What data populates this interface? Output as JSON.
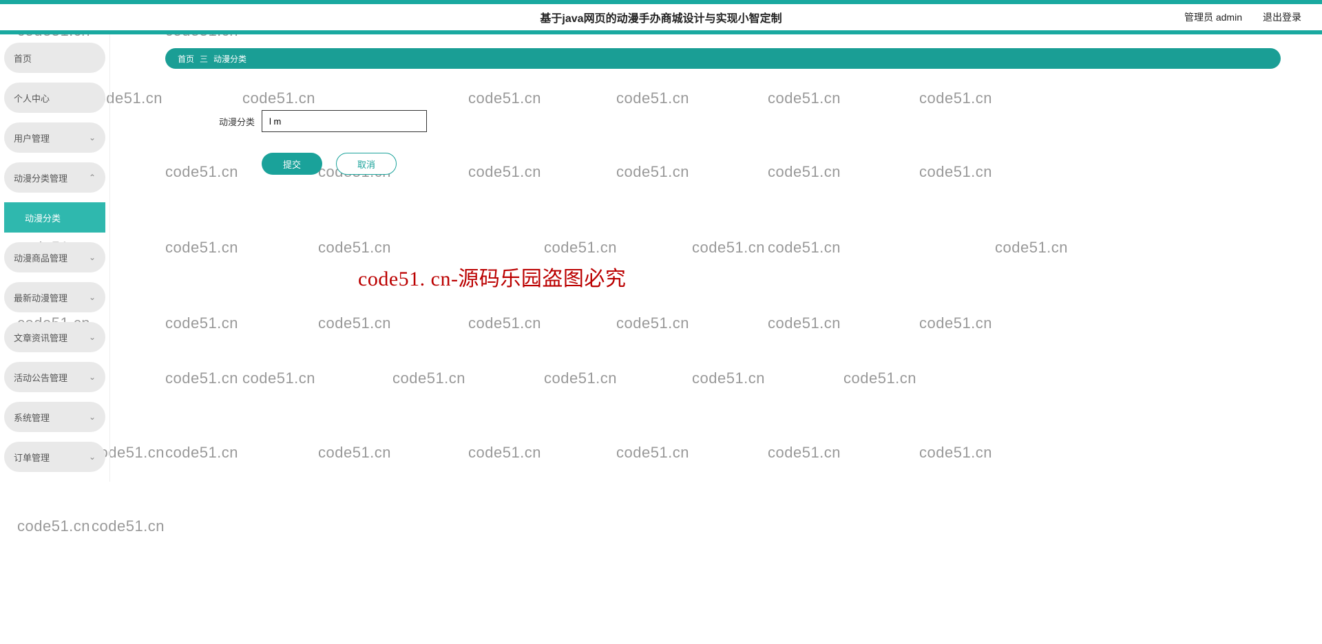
{
  "header": {
    "title": "基于java网页的动漫手办商城设计与实现小智定制",
    "admin_label": "管理员 admin",
    "logout_label": "退出登录"
  },
  "sidebar": {
    "items": [
      {
        "label": "首页",
        "has_arrow": false
      },
      {
        "label": "个人中心",
        "has_arrow": false
      },
      {
        "label": "用户管理",
        "has_arrow": true,
        "expanded": false
      },
      {
        "label": "动漫分类管理",
        "has_arrow": true,
        "expanded": true,
        "children": [
          {
            "label": "动漫分类"
          }
        ]
      },
      {
        "label": "动漫商品管理",
        "has_arrow": true,
        "expanded": false
      },
      {
        "label": "最新动漫管理",
        "has_arrow": true,
        "expanded": false
      },
      {
        "label": "文章资讯管理",
        "has_arrow": true,
        "expanded": false
      },
      {
        "label": "活动公告管理",
        "has_arrow": true,
        "expanded": false
      },
      {
        "label": "系统管理",
        "has_arrow": true,
        "expanded": false
      },
      {
        "label": "订单管理",
        "has_arrow": true,
        "expanded": false
      }
    ]
  },
  "breadcrumb": {
    "home": "首页",
    "sep": "三",
    "current": "动漫分类"
  },
  "form": {
    "category_label": "动漫分类",
    "category_value": "l m",
    "submit_label": "提交",
    "cancel_label": "取消"
  },
  "watermark": {
    "text": "code51.cn",
    "big_text": "code51. cn-源码乐园盗图必究"
  }
}
